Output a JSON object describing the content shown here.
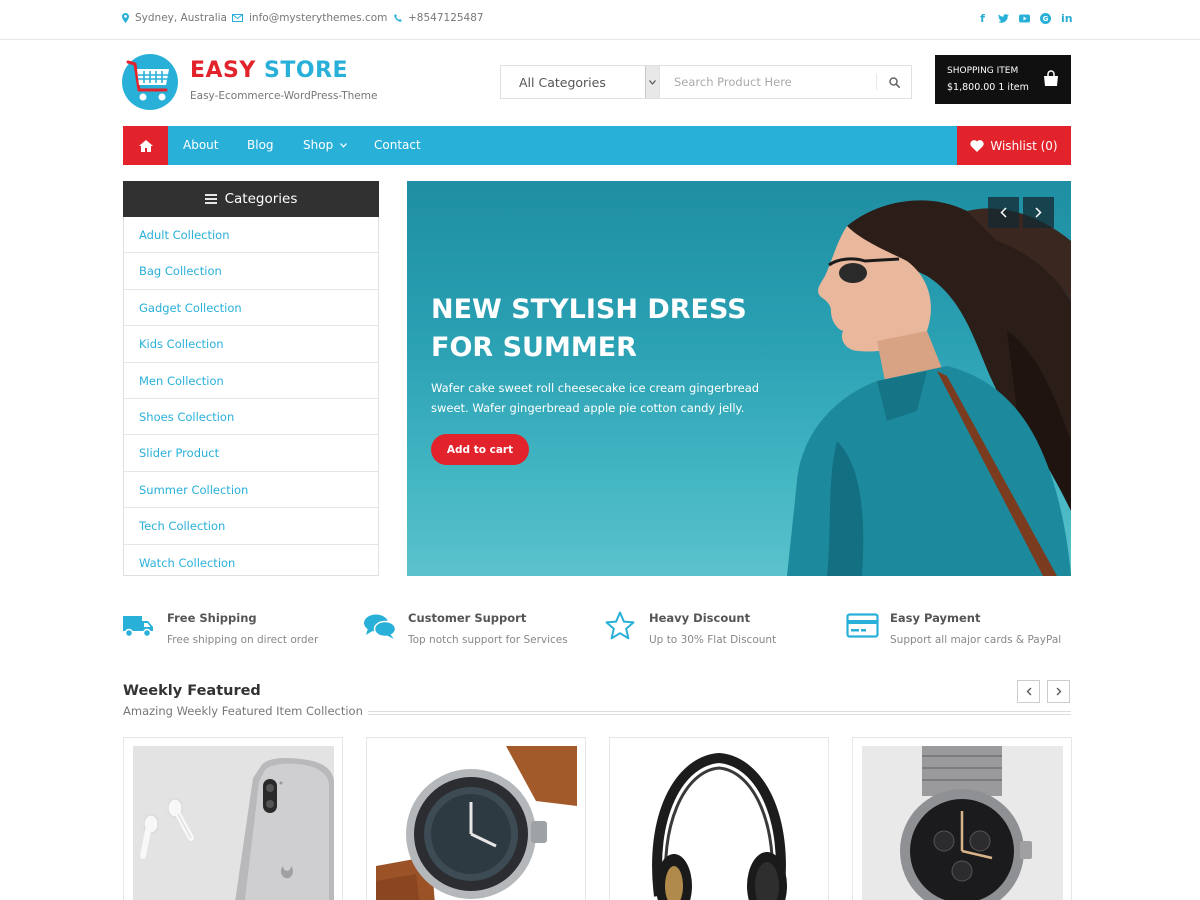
{
  "topbar": {
    "location": "Sydney, Australia",
    "email": "info@mysterythemes.com",
    "phone": "+8547125487",
    "social": [
      {
        "icon": "facebook-icon",
        "glyph": "f"
      },
      {
        "icon": "twitter-icon",
        "glyph": "t"
      },
      {
        "icon": "youtube-icon",
        "glyph": "▶"
      },
      {
        "icon": "google-plus-icon",
        "glyph": "G"
      },
      {
        "icon": "linkedin-icon",
        "glyph": "in"
      }
    ]
  },
  "brand": {
    "title_a": "EASY",
    "title_b": "STORE",
    "tagline": "Easy-Ecommerce-WordPress-Theme",
    "colors": {
      "red": "#e3232c",
      "blue": "#29b0d9",
      "dark": "#101010"
    }
  },
  "search": {
    "category": "All Categories",
    "placeholder": "Search Product Here"
  },
  "cart": {
    "label": "SHOPPING ITEM",
    "summary": "$1,800.00 1 item"
  },
  "nav": {
    "items": [
      "About",
      "Blog",
      "Shop",
      "Contact"
    ],
    "wishlist": "Wishlist (0)"
  },
  "categories": {
    "heading": "Categories",
    "items": [
      "Adult Collection",
      "Bag Collection",
      "Gadget Collection",
      "Kids Collection",
      "Men Collection",
      "Shoes Collection",
      "Slider Product",
      "Summer Collection",
      "Tech Collection",
      "Watch Collection"
    ]
  },
  "slider": {
    "heading": "NEW STYLISH DRESS FOR SUMMER",
    "description": "Wafer cake sweet roll cheesecake ice cream gingerbread sweet. Wafer gingerbread apple pie cotton candy jelly.",
    "button": "Add to cart"
  },
  "features": [
    {
      "icon": "truck-icon",
      "title": "Free Shipping",
      "desc": "Free shipping on direct order"
    },
    {
      "icon": "chat-bubbles-icon",
      "title": "Customer Support",
      "desc": "Top notch support for Services"
    },
    {
      "icon": "star-icon",
      "title": "Heavy Discount",
      "desc": "Up to 30% Flat Discount"
    },
    {
      "icon": "credit-card-icon",
      "title": "Easy Payment",
      "desc": "Support all major cards & PayPal"
    }
  ],
  "weekly": {
    "title": "Weekly Featured",
    "subtitle": "Amazing Weekly Featured Item Collection"
  },
  "products": [
    {
      "image": "phone-and-earbuds"
    },
    {
      "image": "wristwatch-leather-strap"
    },
    {
      "image": "headphones"
    },
    {
      "image": "chronograph-watch"
    }
  ]
}
